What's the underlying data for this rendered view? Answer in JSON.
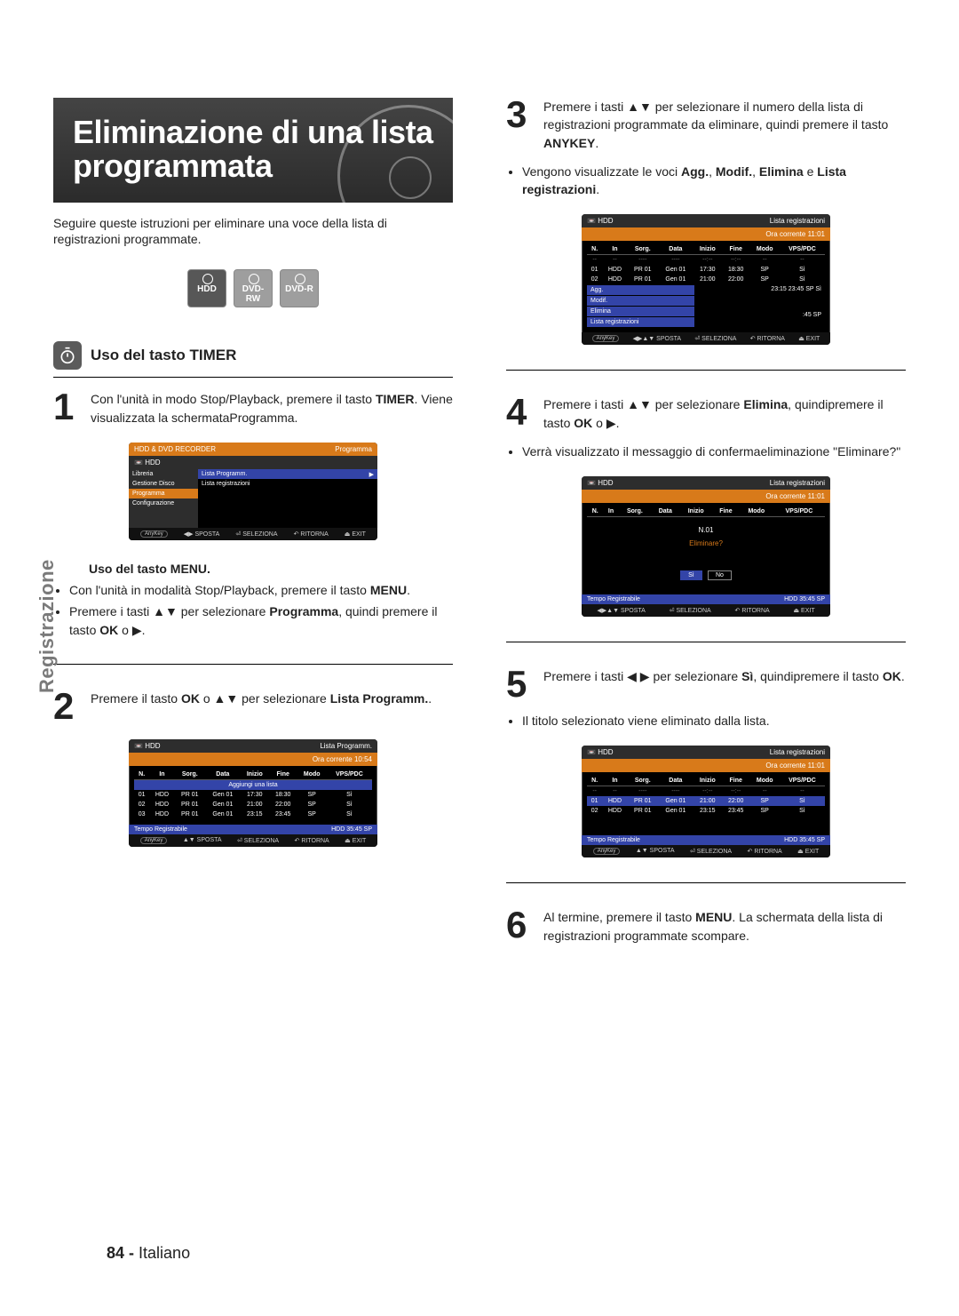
{
  "title_line1": "Eliminazione di una lista",
  "title_line2": "programmata",
  "intro": "Seguire queste istruzioni per eliminare una voce della lista di registrazioni programmate.",
  "badges": [
    "HDD",
    "DVD-RW",
    "DVD-R"
  ],
  "section_timer": "Uso del tasto TIMER",
  "steps": {
    "s1": {
      "n": "1",
      "pre": "Con l'unità in modo Stop/Playback, premere il tasto ",
      "bold": "TIMER",
      "post": ". Viene visualizzata la schermataProgramma."
    },
    "menu_head": "Uso del tasto MENU.",
    "menu_b1_pre": "Con l'unità in modalità Stop/Playback, premere il tasto ",
    "menu_b1_bold": "MENU",
    "menu_b1_post": ".",
    "menu_b2_pre": "Premere i tasti ",
    "menu_b2_sym": "▲▼",
    "menu_b2_mid": " per selezionare ",
    "menu_b2_bold": "Programma",
    "menu_b2_post": ", quindi premere il tasto ",
    "menu_b2_bold2": "OK",
    "menu_b2_post2": " o ",
    "menu_b2_sym2": "▶",
    "menu_b2_post3": ".",
    "s2": {
      "n": "2",
      "pre": "Premere il tasto ",
      "bold": "OK",
      "mid": " o ",
      "sym": "▲▼",
      "mid2": " per selezionare ",
      "bold2": "Lista Programm.",
      "post": "."
    },
    "s3": {
      "n": "3",
      "pre": "Premere i tasti ",
      "sym": "▲▼",
      "mid": " per selezionare il numero della lista di registrazioni programmate da eliminare, quindi premere il tasto ",
      "bold": "ANYKEY",
      "post": "."
    },
    "s3_bullet_pre": "Vengono visualizzate le voci ",
    "s3_bullet_bold1": "Agg.",
    "s3_bullet_mid1": ", ",
    "s3_bullet_bold2": "Modif.",
    "s3_bullet_mid2": ", ",
    "s3_bullet_bold3": "Elimina",
    "s3_bullet_mid3": " e ",
    "s3_bullet_bold4": "Lista registrazioni",
    "s3_bullet_post": ".",
    "s4": {
      "n": "4",
      "pre": "Premere i tasti ",
      "sym": "▲▼",
      "mid": " per selezionare ",
      "bold": "Elimina",
      "post": ", quindipremere il tasto ",
      "bold2": "OK",
      "post2": " o ",
      "sym2": "▶",
      "post3": "."
    },
    "s4_bullet": "Verrà visualizzato il messaggio di confermaeliminazione \"Eliminare?\"",
    "s5": {
      "n": "5",
      "pre": "Premere i tasti ",
      "sym": "◀ ▶",
      "mid": " per selezionare ",
      "bold": "Sì",
      "post": ", quindipremere il tasto ",
      "bold2": "OK",
      "post2": "."
    },
    "s5_bullet": "Il titolo selezionato viene eliminato dalla lista.",
    "s6": {
      "n": "6",
      "pre": "Al termine, premere il tasto ",
      "bold": "MENU",
      "post": ". La schermata della lista di registrazioni programmate scompare."
    }
  },
  "osd": {
    "recorder_title": "HDD & DVD RECORDER",
    "programma": "Programma",
    "hdd": "HDD",
    "side_items": [
      "Libreria",
      "Gestione Disco",
      "Programma",
      "Configurazione"
    ],
    "main_items": [
      "Lista Programm.",
      "Lista registrazioni"
    ],
    "footer": {
      "anykey": "AnyKey",
      "sposta": "SPOSTA",
      "seleziona": "SELEZIONA",
      "ritorna": "RITORNA",
      "exit": "EXIT",
      "sposta_lr": "◀▶ SPOSTA",
      "sposta_ud": "▲▼ SPOSTA",
      "sposta_udlr": "◀▶▲▼ SPOSTA"
    },
    "lista_programm": "Lista Programm.",
    "lista_reg": "Lista registrazioni",
    "ora_corrente": "Ora corrente",
    "time_1054": "10:54",
    "time_1101": "11:01",
    "headers": [
      "N.",
      "In",
      "Sorg.",
      "Data",
      "Inizio",
      "Fine",
      "Modo",
      "VPS/PDC"
    ],
    "rows3": [
      [
        "01",
        "HDD",
        "PR 01",
        "Gen 01",
        "17:30",
        "18:30",
        "SP",
        "Sì"
      ],
      [
        "02",
        "HDD",
        "PR 01",
        "Gen 01",
        "21:00",
        "22:00",
        "SP",
        "Sì"
      ],
      [
        "03",
        "HDD",
        "PR 01",
        "Gen 01",
        "23:15",
        "23:45",
        "SP",
        "Sì"
      ]
    ],
    "rows2": [
      [
        "01",
        "HDD",
        "PR 01",
        "Gen 01",
        "21:00",
        "22:00",
        "SP",
        "Sì"
      ],
      [
        "02",
        "HDD",
        "PR 01",
        "Gen 01",
        "23:15",
        "23:45",
        "SP",
        "Sì"
      ]
    ],
    "aggiungi": "Aggiungi una lista",
    "tempo_reg": "Tempo Registrabile",
    "tempo_val": "HDD  35:45 SP",
    "context_menu": [
      "Agg.",
      "Modif.",
      "Elimina",
      "Lista registrazioni"
    ],
    "ctx_time": "23:15   23:45   SP   Sì",
    "ctx_time_foot": ":45 SP",
    "confirm_n": "N.01",
    "confirm_q": "Eliminare?",
    "si": "Sì",
    "no": "No"
  },
  "side_tab": "Registrazione",
  "page_no_num": "84 -",
  "page_no_lang": " Italiano"
}
